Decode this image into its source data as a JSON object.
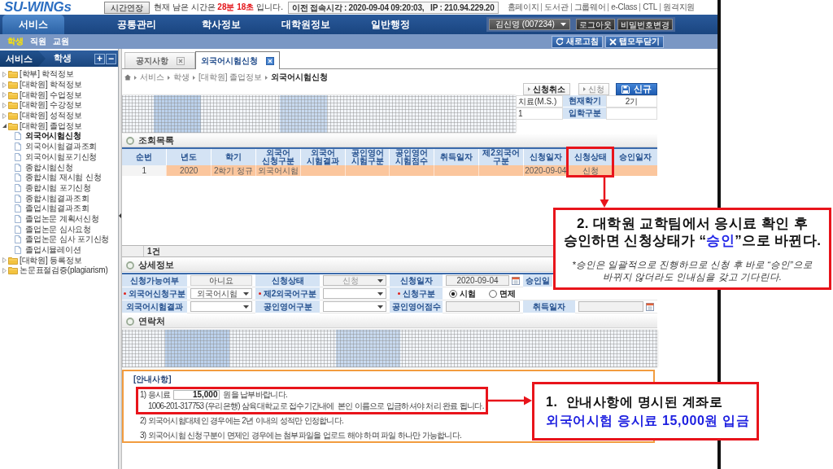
{
  "header": {
    "logo": "SU-WINGs",
    "extend_button": "시간연장",
    "remaining_time": "현재 남은 시간은 **28분 18초** 입니다.",
    "last_access": "이전 접속시각 : 2020-09-04 09:20:03,   IP : 210.94.229.20",
    "links": [
      "홈페이지",
      "도서관",
      "그룹웨어",
      "e-Class",
      "CTL",
      "원격지원"
    ]
  },
  "nav": {
    "tabs": [
      {
        "label": "서비스",
        "selected": true
      },
      {
        "label": "공통관리",
        "selected": false
      },
      {
        "label": "학사정보",
        "selected": false
      },
      {
        "label": "대학원정보",
        "selected": false
      },
      {
        "label": "일반행정",
        "selected": false
      }
    ],
    "user_select": "김신영 (007234)",
    "buttons": [
      "로그아웃",
      "비밀번호변경"
    ]
  },
  "subnav": {
    "roles": [
      {
        "label": "학생",
        "selected": true
      },
      {
        "label": "직원",
        "selected": false
      },
      {
        "label": "교원",
        "selected": false
      }
    ],
    "buttons": [
      {
        "label": "새로고침",
        "kind": "refresh"
      },
      {
        "label": "탭모두닫기",
        "kind": "close_all"
      }
    ]
  },
  "sidebar": {
    "breadcrumb": [
      "서비스",
      "학생"
    ],
    "expand_all": "+",
    "collapse_all": "−",
    "items": [
      {
        "kind": "folder",
        "label": "[학부] 학적정보",
        "expanded": false
      },
      {
        "kind": "folder",
        "label": "[대학원] 학적정보",
        "expanded": false
      },
      {
        "kind": "folder",
        "label": "[대학원] 수업정보",
        "expanded": false
      },
      {
        "kind": "folder",
        "label": "[대학원] 수강정보",
        "expanded": false
      },
      {
        "kind": "folder",
        "label": "[대학원] 성적정보",
        "expanded": false
      },
      {
        "kind": "folder",
        "label": "[대학원] 졸업정보",
        "expanded": true,
        "children": [
          {
            "kind": "page",
            "label": "외국어시험신청",
            "selected": true
          },
          {
            "kind": "page",
            "label": "외국어시험결과조회",
            "selected": false
          },
          {
            "kind": "page",
            "label": "외국어시험포기신청",
            "selected": false
          },
          {
            "kind": "page",
            "label": "종합시험신청",
            "selected": false
          },
          {
            "kind": "page",
            "label": "종합시험 재시험 신청",
            "selected": false
          },
          {
            "kind": "page",
            "label": "종합시험 포기신청",
            "selected": false
          },
          {
            "kind": "page",
            "label": "종합시험결과조회",
            "selected": false
          },
          {
            "kind": "page",
            "label": "졸업시험결과조회",
            "selected": false
          },
          {
            "kind": "page",
            "label": "졸업논문 계획서신청",
            "selected": false
          },
          {
            "kind": "page",
            "label": "졸업논문 심사요청",
            "selected": false
          },
          {
            "kind": "page",
            "label": "졸업논문 심사 포기신청",
            "selected": false
          },
          {
            "kind": "page",
            "label": "졸업시뮬레이션",
            "selected": false
          }
        ]
      },
      {
        "kind": "folder",
        "label": "[대학원] 등록정보",
        "expanded": false
      },
      {
        "kind": "folder",
        "label": "논문표절검증(plagiarism)",
        "expanded": false
      }
    ]
  },
  "tabs": [
    {
      "label": "공지사항",
      "selected": false
    },
    {
      "label": "외국어시험신청",
      "selected": true
    }
  ],
  "breadcrumb": [
    "서비스",
    "학생",
    "[대학원] 졸업정보",
    "외국어시험신청"
  ],
  "actions": [
    {
      "label": "신청취소",
      "kind": "plain",
      "disabled": false
    },
    {
      "label": "신청",
      "kind": "plain",
      "disabled": true
    },
    {
      "label": "신규",
      "kind": "primary",
      "disabled": false
    }
  ],
  "student_info": {
    "rows": [
      {
        "partial_value": "치료(M.S.)",
        "label": "현재학기",
        "value": "2기"
      },
      {
        "partial_value": "1",
        "label": "입학구분"
      }
    ]
  },
  "list": {
    "title": "조회목록",
    "columns": [
      "순번",
      "년도",
      "학기",
      "외국어 신청구분",
      "외국어 시험결과",
      "공인영어 시험구분",
      "공인영어 시험점수",
      "취득일자",
      "제2외국어 구분",
      "신청일자",
      "신청상태",
      "승인일자"
    ],
    "rows": [
      {
        "no": "1",
        "year": "2020",
        "semester": "2학기 정규",
        "application_type": "외국어시험",
        "applied_on": "2020-09-04",
        "status": "신청",
        "selected": true
      }
    ],
    "count": "1건"
  },
  "detail": {
    "title": "상세정보",
    "rows": [
      {
        "fields": [
          {
            "label": "신청가능여부",
            "kind": "display",
            "required": false,
            "value": "아니요"
          },
          {
            "label": "신청상태",
            "kind": "select",
            "required": false,
            "disabled": true,
            "value": "신청"
          },
          {
            "label": "신청일자",
            "kind": "date",
            "required": false,
            "disabled": true,
            "value": "2020-09-04"
          },
          {
            "label": "승인일",
            "kind": "label_only",
            "required": false
          }
        ]
      },
      {
        "fields": [
          {
            "label": "외국어신청구분",
            "kind": "select",
            "required": true,
            "disabled": false,
            "value": "외국어시험"
          },
          {
            "label": "제2외국어구분",
            "kind": "select",
            "required": true,
            "disabled": false
          },
          {
            "label": "신청구분",
            "kind": "radio",
            "required": true,
            "options": [
              {
                "label": "시험",
                "selected": true
              },
              {
                "label": "면제",
                "selected": false
              }
            ]
          }
        ]
      },
      {
        "fields": [
          {
            "label": "외국어시험결과",
            "kind": "select",
            "required": false,
            "disabled": false
          },
          {
            "label": "공인영어구분",
            "kind": "select",
            "required": false,
            "disabled": false
          },
          {
            "label": "공인영어점수",
            "kind": "input",
            "required": false,
            "disabled": true
          },
          {
            "label": "취득일자",
            "kind": "date",
            "required": false,
            "disabled": true
          }
        ]
      }
    ]
  },
  "contact": {
    "title": "연락처"
  },
  "notice": {
    "title": "[안내사항]",
    "lines": [
      {
        "kind": "fee",
        "before": "1) 응시료",
        "value": "15,000",
        "after": "원을 납부바랍니다."
      },
      {
        "kind": "detail",
        "text": "1006-201-317753 (우리은행) 삼육대학교로 접수기간내에  본인 이름으로 입금하셔야 처리 완료 됩니다."
      },
      {
        "kind": "item",
        "text": "2) 외국어시험대체인 경우에는 2년 이내의 성적만 인정합니다."
      },
      {
        "kind": "item",
        "text": "3) 외국어시험 신청구분이 면제인 경우에는 첨부파일을 업로드 해야 하며 파일 하나만 가능합니다."
      }
    ]
  },
  "callouts": [
    {
      "kind": "status",
      "lines": [
        "2. 대학원 교학팀에서 응시료 확인 후",
        "승인하면 신청상태가 “**승인**”으로 바뀐다."
      ],
      "note": "*승인은 일괄적으로 진행하므로 신청 후 바로 “승인”으로 바뀌지 않더라도 인내심을 갖고 기다린다."
    },
    {
      "kind": "payment",
      "lines": [
        "1.  안내사항에 명시된 계좌로",
        "**외국어시험 응시료 15,000원 입금**"
      ]
    }
  ]
}
